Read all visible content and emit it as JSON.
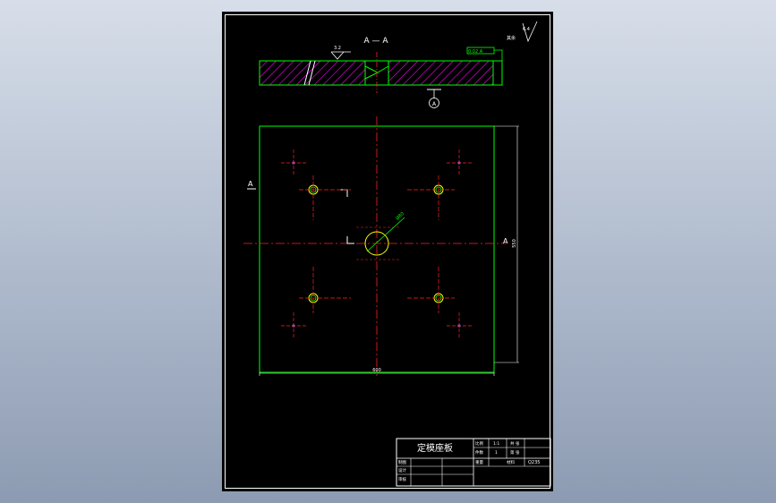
{
  "drawing": {
    "section_label": "A — A",
    "section_marker_left": "A",
    "section_marker_right": "A",
    "datum_label": "A",
    "roughness_top_left": "3.2",
    "roughness_top_right": "6.4",
    "roughness_other_prefix": "其余",
    "tolerance_frame": "0.02 A",
    "center_hole_label": "Ø80",
    "width_dimension": "600",
    "height_dimension": "550",
    "colors": {
      "background": "#000000",
      "border": "#ffffff",
      "outline": "#00ff00",
      "centerline": "#ff2020",
      "hatch": "#ff00ff",
      "hole": "#ffff00"
    }
  },
  "title_block": {
    "part_name": "定模座板",
    "label_scale": "比例",
    "label_qty": "件数",
    "scale_value": "1:1",
    "qty_value": "1",
    "label_weight": "重量",
    "label_material": "材料",
    "material_value": "Q235",
    "label_drawn": "制图",
    "label_designed": "设计",
    "label_checked": "审核",
    "label_sheet": "共  张",
    "label_sheet2": "第  张"
  }
}
